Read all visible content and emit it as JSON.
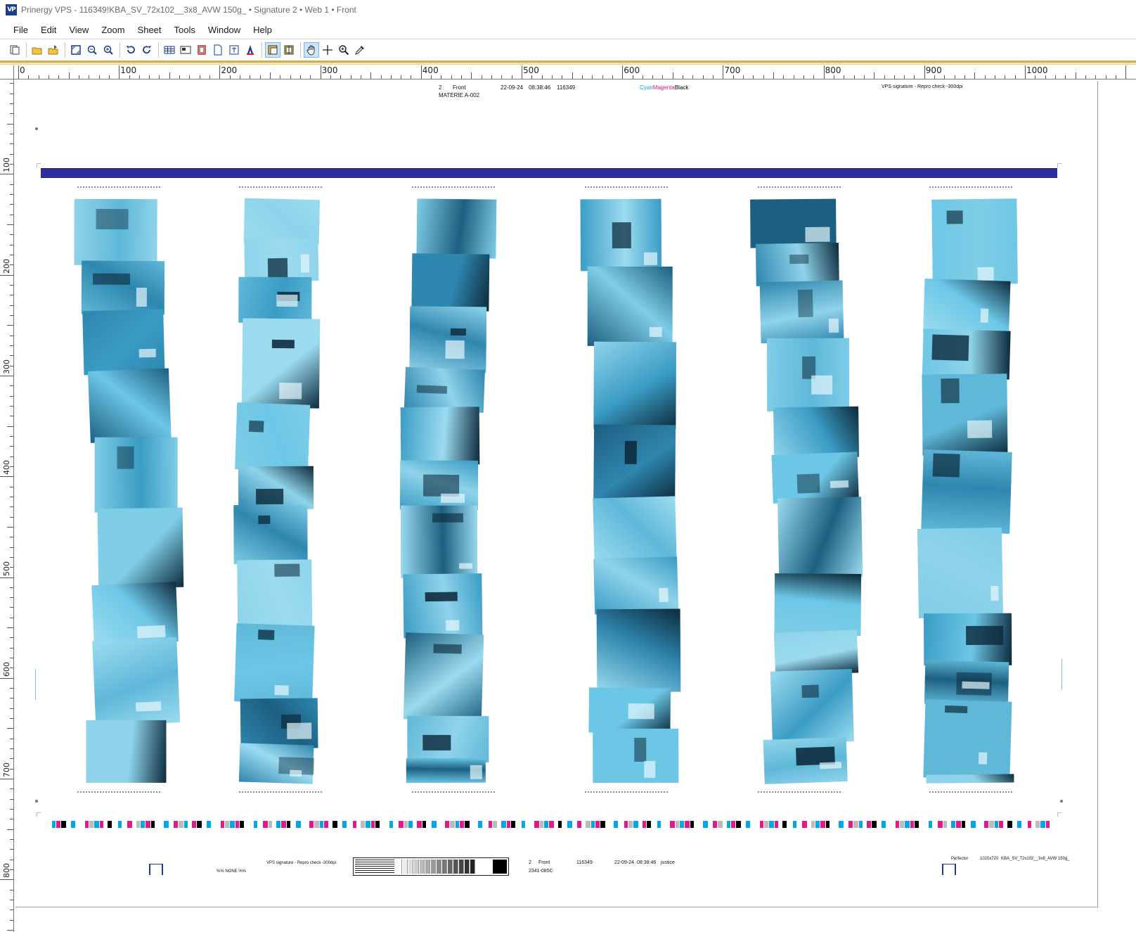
{
  "window": {
    "icon_text": "VP",
    "title": "Prinergy VPS - 116349!KBA_SV_72x102__3x8_AVW 150g_ • Signature 2 • Web 1 • Front"
  },
  "menu": [
    "File",
    "Edit",
    "View",
    "Zoom",
    "Sheet",
    "Tools",
    "Window",
    "Help"
  ],
  "toolbar": {
    "buttons": [
      {
        "name": "copy-sheet-icon"
      },
      {
        "sep": true
      },
      {
        "name": "open-folder-icon"
      },
      {
        "name": "open-folder-arrow-icon"
      },
      {
        "sep": true
      },
      {
        "name": "fit-page-icon"
      },
      {
        "name": "zoom-out-icon"
      },
      {
        "name": "zoom-in-icon"
      },
      {
        "sep": true
      },
      {
        "name": "rotate-left-icon"
      },
      {
        "name": "rotate-right-icon"
      },
      {
        "sep": true
      },
      {
        "name": "grid-view-icon"
      },
      {
        "name": "layout-view-icon"
      },
      {
        "name": "separation-icon"
      },
      {
        "name": "page-icon"
      },
      {
        "name": "signature-icon"
      },
      {
        "name": "text-color-icon"
      },
      {
        "sep": true
      },
      {
        "name": "select-frame-icon",
        "active": true
      },
      {
        "name": "select-split-icon"
      },
      {
        "sep": true
      },
      {
        "name": "hand-pan-icon",
        "active": true
      },
      {
        "name": "crosshair-icon"
      },
      {
        "name": "zoom-tool-icon"
      },
      {
        "name": "eyedropper-icon"
      }
    ]
  },
  "ruler": {
    "h_labels": [
      "0",
      "100",
      "200",
      "300",
      "400",
      "500",
      "600",
      "700",
      "800",
      "900",
      "1000"
    ],
    "v_labels": [
      "100",
      "200",
      "300",
      "400",
      "500",
      "600",
      "700",
      "800"
    ]
  },
  "sheet": {
    "patches": [
      {
        "label": "K",
        "color": "#000000"
      },
      {
        "label": "C",
        "color": "#00a6e6"
      },
      {
        "label": "M",
        "color": "#e6168c"
      }
    ],
    "header": {
      "sig_number": "2",
      "side": "Front",
      "materie": "MATERIE A-002",
      "date": "22-09-24",
      "time": "08:38:46",
      "job": "116349",
      "sep_cyan": "Cyan",
      "sep_magenta": "Magenta",
      "sep_black": "Black",
      "vps_right": "VPS signature - Repro check -300dpi"
    },
    "footer": {
      "vps_left": "VPS signature - Repro check -300dpi",
      "none_text": "%% NONE %%",
      "sig_number": "2",
      "side": "Front",
      "job": "116349",
      "date": "22-09-24",
      "time": "08:38:46",
      "operator": "justice",
      "plate_id": "2341-085C",
      "press": "Perfector",
      "sheet_size": "1020x720",
      "template": "KBA_SV_72x102__3x8_AVW 150g_"
    },
    "colors": {
      "cyan": "#00a6e6",
      "magenta": "#e6168c",
      "black": "#000000",
      "blue_bar": "#2c2d9e",
      "photo_tint": "#6cc7e6"
    }
  }
}
